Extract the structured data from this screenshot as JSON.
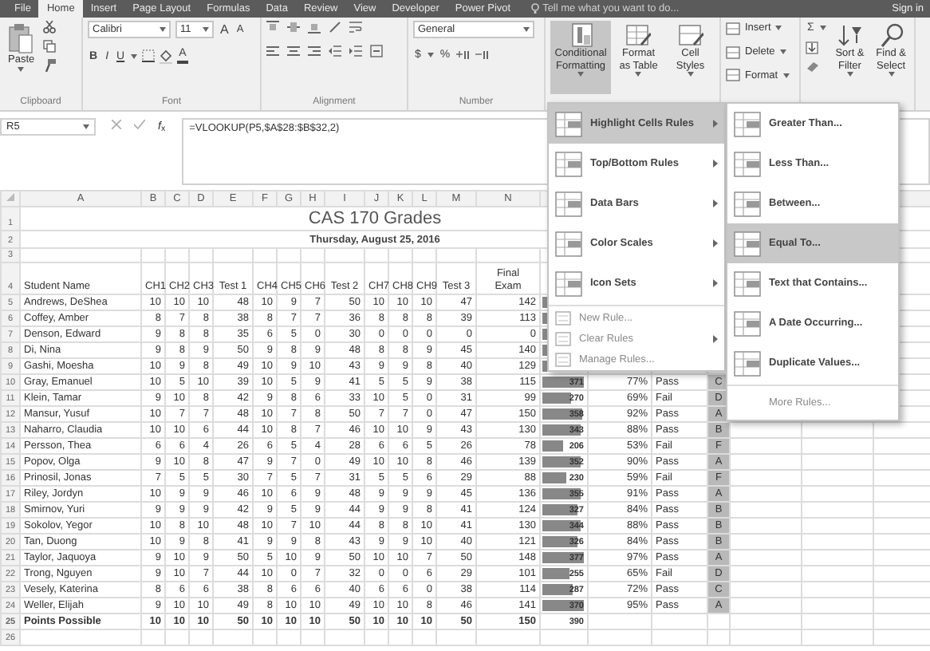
{
  "ribbon_tabs": [
    {
      "label": "File",
      "selected": false
    },
    {
      "label": "Home",
      "selected": true
    },
    {
      "label": "Insert",
      "selected": false
    },
    {
      "label": "Page Layout",
      "selected": false
    },
    {
      "label": "Formulas",
      "selected": false
    },
    {
      "label": "Data",
      "selected": false
    },
    {
      "label": "Review",
      "selected": false
    },
    {
      "label": "View",
      "selected": false
    },
    {
      "label": "Developer",
      "selected": false
    },
    {
      "label": "Power Pivot",
      "selected": false
    }
  ],
  "tell_me": "Tell me what you want to do...",
  "sign_in": "Sign in",
  "ribbon": {
    "clipboard": {
      "paste": "Paste",
      "label": "Clipboard"
    },
    "font": {
      "name": "Calibri",
      "size": "11",
      "grow": "A",
      "shrink": "A",
      "styles": [
        "B",
        "I",
        "U"
      ],
      "color_button": "A",
      "label": "Font"
    },
    "alignment": {
      "label": "Alignment"
    },
    "number": {
      "format": "General",
      "currency": "$",
      "percent": "%",
      "label": "Number"
    },
    "styles": [
      {
        "label": "Conditional Formatting",
        "expanded": true
      },
      {
        "label": "Format as Table",
        "expanded": false
      },
      {
        "label": "Cell Styles",
        "expanded": false
      }
    ],
    "cells": [
      "Insert",
      "Delete",
      "Format"
    ],
    "editing": {
      "sum": "Σ",
      "buttons": [
        "Sort & Filter",
        "Find & Select"
      ]
    }
  },
  "formula_bar": {
    "name_box": "R5",
    "function_label": "*f*$_{x}$",
    "formula": "=VLOOKUP(P5,$A$28:$B$32,2)"
  },
  "sheet": {
    "column_headers": [
      "A",
      "B",
      "C",
      "D",
      "E",
      "F",
      "G",
      "H",
      "I",
      "J",
      "K",
      "L",
      "M",
      "N"
    ],
    "top_row_numbers": [
      "1",
      "2",
      "3",
      "4"
    ],
    "title": "CAS 170 Grades",
    "date": "Thursday, August 25, 2016",
    "headers": [
      "Student Name",
      "CH1",
      "CH2",
      "CH3",
      "Test 1",
      "CH4",
      "CH5",
      "CH6",
      "Test 2",
      "CH7",
      "CH8",
      "CH9",
      "Test 3",
      "Final Exam"
    ],
    "rows": [
      {
        "kind": "student",
        "number": "5",
        "name": "Andrews, DeShea",
        "scores": [
          "10",
          "10",
          "10",
          "48",
          "10",
          "9",
          "7",
          "50",
          "10",
          "10",
          "10",
          "47",
          "142"
        ],
        "level": 0.9
      },
      {
        "kind": "student",
        "number": "6",
        "name": "Coffey, Amber",
        "scores": [
          "8",
          "7",
          "8",
          "38",
          "8",
          "7",
          "7",
          "36",
          "8",
          "8",
          "8",
          "39",
          "113"
        ],
        "level": 0.75
      },
      {
        "kind": "student",
        "number": "7",
        "name": "Denson, Edward",
        "scores": [
          "9",
          "8",
          "8",
          "35",
          "6",
          "5",
          "0",
          "30",
          "0",
          "0",
          "0",
          "0",
          "0"
        ],
        "level": 0.4
      },
      {
        "kind": "student",
        "number": "8",
        "name": "Di, Nina",
        "scores": [
          "9",
          "8",
          "9",
          "50",
          "9",
          "8",
          "9",
          "48",
          "8",
          "8",
          "9",
          "45",
          "140"
        ],
        "level": 0.9
      },
      {
        "kind": "student",
        "number": "9",
        "name": "Gashi, Moesha",
        "scores": [
          "10",
          "9",
          "8",
          "49",
          "10",
          "9",
          "10",
          "43",
          "9",
          "9",
          "8",
          "40",
          "129"
        ],
        "level": 0.85
      },
      {
        "kind": "student",
        "number": "10",
        "name": "Gray, Emanuel",
        "scores": [
          "10",
          "5",
          "10",
          "39",
          "10",
          "5",
          "9",
          "41",
          "5",
          "5",
          "9",
          "38",
          "115"
        ],
        "level": 0.95,
        "total": "371",
        "percent": "77%",
        "result": "Pass",
        "grade": "C",
        "grade_selected": true
      },
      {
        "kind": "student",
        "number": "11",
        "name": "Klein, Tamar",
        "scores": [
          "9",
          "10",
          "8",
          "42",
          "9",
          "8",
          "6",
          "33",
          "10",
          "5",
          "0",
          "31",
          "99"
        ],
        "level": 0.69,
        "total": "270",
        "percent": "69%",
        "result": "Fail",
        "grade": "D",
        "grade_selected": true
      },
      {
        "kind": "student",
        "number": "12",
        "name": "Mansur, Yusuf",
        "scores": [
          "10",
          "7",
          "7",
          "48",
          "10",
          "7",
          "8",
          "50",
          "7",
          "7",
          "0",
          "47",
          "150"
        ],
        "level": 0.92,
        "total": "358",
        "percent": "92%",
        "result": "Pass",
        "grade": "A",
        "grade_selected": true
      },
      {
        "kind": "student",
        "number": "13",
        "name": "Naharro, Claudia",
        "scores": [
          "10",
          "10",
          "6",
          "44",
          "10",
          "8",
          "7",
          "46",
          "10",
          "10",
          "9",
          "43",
          "130"
        ],
        "level": 0.88,
        "total": "343",
        "percent": "88%",
        "result": "Pass",
        "grade": "B",
        "grade_selected": true
      },
      {
        "kind": "student",
        "number": "14",
        "name": "Persson, Thea",
        "scores": [
          "6",
          "6",
          "4",
          "26",
          "6",
          "5",
          "4",
          "28",
          "6",
          "6",
          "5",
          "26",
          "78"
        ],
        "level": 0.53,
        "total": "206",
        "percent": "53%",
        "result": "Fail",
        "grade": "F",
        "grade_selected": true
      },
      {
        "kind": "student",
        "number": "15",
        "name": "Popov, Olga",
        "scores": [
          "9",
          "10",
          "8",
          "47",
          "9",
          "7",
          "0",
          "49",
          "10",
          "10",
          "8",
          "46",
          "139"
        ],
        "level": 0.9,
        "total": "352",
        "percent": "90%",
        "result": "Pass",
        "grade": "A",
        "grade_selected": true
      },
      {
        "kind": "student",
        "number": "16",
        "name": "Prinosil, Jonas",
        "scores": [
          "7",
          "5",
          "5",
          "30",
          "7",
          "5",
          "7",
          "31",
          "5",
          "5",
          "6",
          "29",
          "88"
        ],
        "level": 0.59,
        "total": "230",
        "percent": "59%",
        "result": "Fail",
        "grade": "F",
        "grade_selected": true
      },
      {
        "kind": "student",
        "number": "17",
        "name": "Riley, Jordyn",
        "scores": [
          "10",
          "9",
          "9",
          "46",
          "10",
          "6",
          "9",
          "48",
          "9",
          "9",
          "9",
          "45",
          "136"
        ],
        "level": 0.91,
        "total": "355",
        "percent": "91%",
        "result": "Pass",
        "grade": "A",
        "grade_selected": true
      },
      {
        "kind": "student",
        "number": "18",
        "name": "Smirnov, Yuri",
        "scores": [
          "9",
          "9",
          "9",
          "42",
          "9",
          "5",
          "9",
          "44",
          "9",
          "9",
          "8",
          "41",
          "124"
        ],
        "level": 0.84,
        "total": "327",
        "percent": "84%",
        "result": "Pass",
        "grade": "B",
        "grade_selected": true
      },
      {
        "kind": "student",
        "number": "19",
        "name": "Sokolov, Yegor",
        "scores": [
          "10",
          "8",
          "10",
          "48",
          "10",
          "7",
          "10",
          "44",
          "8",
          "8",
          "10",
          "41",
          "130"
        ],
        "level": 0.88,
        "total": "344",
        "percent": "88%",
        "result": "Pass",
        "grade": "B",
        "grade_selected": true
      },
      {
        "kind": "student",
        "number": "20",
        "name": "Tan, Duong",
        "scores": [
          "10",
          "9",
          "8",
          "41",
          "9",
          "9",
          "8",
          "43",
          "9",
          "9",
          "10",
          "40",
          "121"
        ],
        "level": 0.84,
        "total": "326",
        "percent": "84%",
        "result": "Pass",
        "grade": "B",
        "grade_selected": true
      },
      {
        "kind": "student",
        "number": "21",
        "name": "Taylor, Jaquoya",
        "scores": [
          "9",
          "10",
          "9",
          "50",
          "5",
          "10",
          "9",
          "50",
          "10",
          "10",
          "7",
          "50",
          "148"
        ],
        "level": 0.97,
        "total": "377",
        "percent": "97%",
        "result": "Pass",
        "grade": "A",
        "grade_selected": true
      },
      {
        "kind": "student",
        "number": "22",
        "name": "Trong, Nguyen",
        "scores": [
          "9",
          "10",
          "7",
          "44",
          "10",
          "0",
          "7",
          "32",
          "0",
          "0",
          "6",
          "29",
          "101"
        ],
        "level": 0.65,
        "total": "255",
        "percent": "65%",
        "result": "Fail",
        "grade": "D",
        "grade_selected": true
      },
      {
        "kind": "student",
        "number": "23",
        "name": "Vesely, Katerina",
        "scores": [
          "8",
          "6",
          "6",
          "38",
          "8",
          "6",
          "6",
          "40",
          "6",
          "6",
          "0",
          "38",
          "114"
        ],
        "level": 0.74,
        "total": "287",
        "percent": "72%",
        "result": "Pass",
        "grade": "C",
        "grade_selected": true
      },
      {
        "kind": "student",
        "number": "24",
        "name": "Weller, Elijah",
        "scores": [
          "9",
          "10",
          "10",
          "49",
          "8",
          "10",
          "10",
          "49",
          "10",
          "10",
          "8",
          "46",
          "141"
        ],
        "level": 0.95,
        "total": "370",
        "percent": "95%",
        "result": "Pass",
        "grade": "A",
        "grade_selected": true
      },
      {
        "kind": "total",
        "number": "25",
        "name": "Points Possible",
        "scores": [
          "10",
          "10",
          "10",
          "50",
          "10",
          "10",
          "10",
          "50",
          "10",
          "10",
          "10",
          "50",
          "150"
        ],
        "total": "390",
        "grade_selected": false
      }
    ],
    "bottom_row_numbers": [
      "26"
    ]
  },
  "cf_menu": [
    {
      "label": "Highlight Cells Rules",
      "kind": "rule_type",
      "has_submenu": true,
      "selected": true
    },
    {
      "label": "Top/Bottom Rules",
      "kind": "rule_type",
      "has_submenu": true,
      "selected": false
    },
    {
      "label": "Data Bars",
      "kind": "rule_type",
      "has_submenu": true,
      "selected": false
    },
    {
      "label": "Color Scales",
      "kind": "rule_type",
      "has_submenu": true,
      "selected": false
    },
    {
      "label": "Icon Sets",
      "kind": "rule_type",
      "has_submenu": true,
      "selected": false
    },
    {
      "label": "New Rule...",
      "kind": "command",
      "has_submenu": false,
      "selected": false
    },
    {
      "label": "Clear Rules",
      "kind": "command",
      "has_submenu": true,
      "selected": false
    },
    {
      "label": "Manage Rules...",
      "kind": "command",
      "has_submenu": false,
      "selected": false
    }
  ],
  "submenu": [
    {
      "label": "Greater Than...",
      "kind": "rule",
      "selected": false
    },
    {
      "label": "Less Than...",
      "kind": "rule",
      "selected": false
    },
    {
      "label": "Between...",
      "kind": "rule",
      "selected": false
    },
    {
      "label": "Equal To...",
      "kind": "rule",
      "selected": true
    },
    {
      "label": "Text that Contains...",
      "kind": "rule",
      "selected": false
    },
    {
      "label": "A Date Occurring...",
      "kind": "rule",
      "selected": false
    },
    {
      "label": "Duplicate Values...",
      "kind": "rule",
      "selected": false
    },
    {
      "label": "More Rules...",
      "kind": "link",
      "selected": false
    }
  ]
}
